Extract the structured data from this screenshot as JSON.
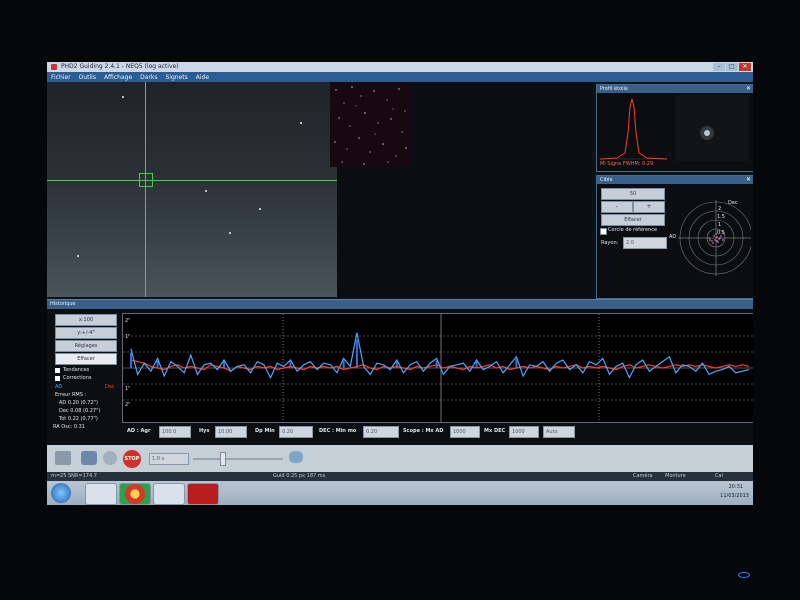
{
  "window": {
    "title": "PHD2 Guiding 2.4.1 - NEQ5 (log active)"
  },
  "menu": [
    "Fichier",
    "Outils",
    "Affichage",
    "Darks",
    "Signets",
    "Aide"
  ],
  "star_profile": {
    "title": "Profil étoile",
    "footer": "Mi Signe FWHM: 0.29"
  },
  "target": {
    "title": "Cible",
    "zoom": "50",
    "button_minus": "-",
    "button_plus": "+",
    "clear_button": "Effacer",
    "ref_circle_label": "Cercle de référence",
    "radius_label": "Rayon:",
    "radius_value": "2.0",
    "axis_ra": "AD",
    "axis_dec": "Dec",
    "ring_labels": [
      "2",
      "1.5",
      "1",
      "0.5"
    ]
  },
  "history": {
    "title": "Historique",
    "xscale": "x:100",
    "yscale": "y:+/-4\"",
    "settings_button": "Réglages",
    "clear_button": "Effacer",
    "trends_label": "Tendances",
    "corrections_label": "Corrections",
    "ra_label": "AD",
    "dec_label": "Dec",
    "rms_title": "Erreur RMS :",
    "rms_ra": "AD 0.20 (0.72\")",
    "rms_dec": "Dec 0.08 (0.27\")",
    "rms_tot": "Tot 0.22 (0.77\")",
    "ra_osc": "RA Osc: 0.31",
    "y_ticks": [
      "2\"",
      "1\"",
      "1\"",
      "2\""
    ]
  },
  "params": {
    "ra_aggr_label": "AD : Agr",
    "ra_aggr_value": "100.0",
    "hys_label": "Hys",
    "hys_value": "10.00",
    "dp_min_label": "Dp Min",
    "dp_min_value": "0.20",
    "dec_min_label": "DEC : Min mo",
    "dec_min_value": "0.20",
    "scope_label": "Scope : Mx AD",
    "mx_ad_value": "1000",
    "mx_dec_label": "Mx DEC",
    "mx_dec_value": "1000",
    "dec_mode": "Auto"
  },
  "toolbar": {
    "exposure": "1.0 s",
    "stop": "STOP"
  },
  "status": {
    "left": "m=25 SNR=174.7",
    "middle": "Guid 0.25 px 187 ms",
    "camera": "Caméra",
    "mount": "Monture",
    "cal": "Cal"
  },
  "taskbar": {
    "time": "20:31",
    "date": "11/03/2013"
  },
  "colors": {
    "ra": "#4aa8ff",
    "dec": "#ff3b2b",
    "panel_title": "#3a5f88",
    "crosshair": "#3fd13f"
  },
  "chart_data": {
    "type": "line",
    "title": "",
    "xlabel": "",
    "ylabel": "",
    "ylim": [
      -3,
      3
    ],
    "series": [
      {
        "name": "AD",
        "values": [
          1.2,
          -0.4,
          0.3,
          -0.2,
          0.6,
          -0.5,
          0.4,
          0.1,
          -0.3,
          0.8,
          -0.4,
          0.2,
          0.3,
          -0.1,
          0.5,
          -0.2,
          0.1,
          0.2,
          -0.3,
          0.4,
          0.2,
          -0.6,
          0.3,
          0.1,
          0.5,
          -0.2,
          0.2,
          0.4,
          -0.1,
          0.3,
          0.2,
          -0.3,
          0.6,
          0.1,
          2.2,
          0.1,
          -0.4,
          0.3,
          0.2,
          -0.1,
          0.5,
          -0.3,
          0.2,
          0.4,
          -0.2,
          0.3,
          0.6,
          -0.4,
          0.1,
          0.2,
          0.3,
          -0.2,
          0.5,
          -0.1,
          0.1,
          0.4,
          -0.3,
          0.2,
          0.7,
          -0.5,
          0.2,
          0.1,
          0.4,
          -0.2,
          0.3,
          0.5,
          -0.1,
          0.2,
          -0.3,
          0.4,
          0.2,
          0.6,
          -0.4,
          0.1,
          0.3,
          -0.6,
          0.2,
          0.5,
          -0.2,
          0.1,
          0.4,
          0.7,
          -0.3,
          0.2,
          0.1,
          -0.2,
          0.3,
          -0.4,
          -0.2,
          -0.1,
          0.1,
          -0.3,
          -0.2,
          -0.1
        ]
      },
      {
        "name": "Dec",
        "values": [
          0.5,
          0.4,
          0.3,
          0.1,
          0.0,
          -0.1,
          0.1,
          0.2,
          0.0,
          0.1,
          0.0,
          -0.1,
          0.2,
          0.1,
          0.0,
          -0.2,
          0.1,
          0.0,
          -0.1,
          0.1,
          0.0,
          0.1,
          -0.1,
          0.0,
          0.1,
          0.0,
          -0.1,
          0.1,
          0.0,
          0.1,
          0.0,
          0.1,
          -0.1,
          0.0,
          0.1,
          0.2,
          0.0,
          -0.1,
          0.1,
          0.0,
          0.1,
          0.0,
          -0.1,
          0.1,
          0.0,
          0.1,
          0.2,
          0.0,
          0.1,
          0.0,
          -0.1,
          0.1,
          0.0,
          0.1,
          0.2,
          0.0,
          0.1,
          -0.1,
          0.0,
          0.1,
          0.0,
          0.1,
          0.0,
          -0.1,
          0.1,
          0.0,
          0.1,
          0.2,
          0.0,
          0.1,
          0.0,
          0.1,
          0.0,
          -0.1,
          0.1,
          0.2,
          0.0,
          0.1,
          0.2,
          0.1,
          0.0,
          0.1,
          0.2,
          0.1,
          0.2,
          0.1,
          0.2,
          0.1,
          0.0,
          0.1,
          0.2,
          0.1,
          0.2,
          0.1
        ]
      }
    ]
  }
}
